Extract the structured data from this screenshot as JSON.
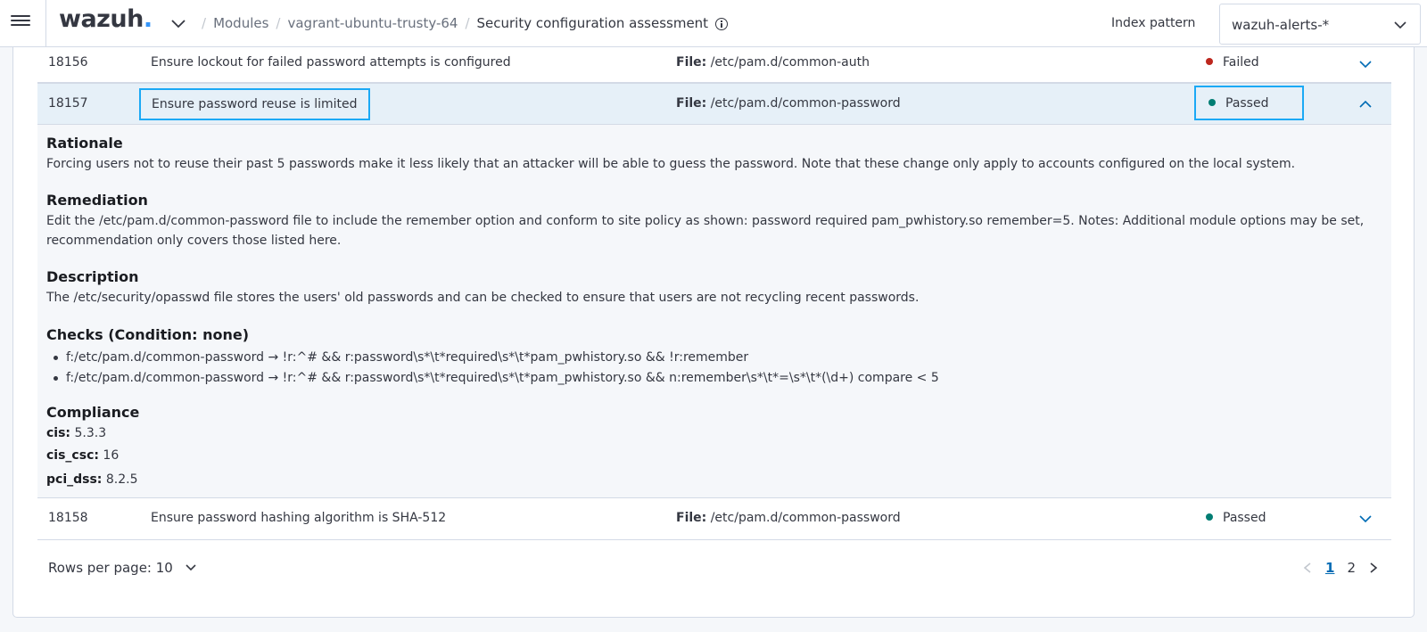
{
  "header": {
    "logo_text": "wazuh",
    "logo_dot": ".",
    "breadcrumbs": [
      "Modules",
      "vagrant-ubuntu-trusty-64",
      "Security configuration assessment"
    ],
    "index_label": "Index pattern",
    "index_value": "wazuh-alerts-*"
  },
  "rows": [
    {
      "id": "18156",
      "title": "Ensure lockout for failed password attempts is configured",
      "file_label": "File:",
      "file": "/etc/pam.d/common-auth",
      "result": "Failed",
      "result_color": "#bd271e"
    },
    {
      "id": "18157",
      "title": "Ensure password reuse is limited",
      "file_label": "File:",
      "file": "/etc/pam.d/common-password",
      "result": "Passed",
      "result_color": "#017d73"
    },
    {
      "id": "18158",
      "title": "Ensure password hashing algorithm is SHA-512",
      "file_label": "File:",
      "file": "/etc/pam.d/common-password",
      "result": "Passed",
      "result_color": "#017d73"
    }
  ],
  "details": {
    "rationale_h": "Rationale",
    "rationale": "Forcing users not to reuse their past 5 passwords make it less likely that an attacker will be able to guess the password. Note that these change only apply to accounts configured on the local system.",
    "remediation_h": "Remediation",
    "remediation": "Edit the /etc/pam.d/common-password file to include the remember option and conform to site policy as shown: password required pam_pwhistory.so remember=5. Notes: Additional module options may be set, recommendation only covers those listed here.",
    "description_h": "Description",
    "description": "The /etc/security/opasswd file stores the users' old passwords and can be checked to ensure that users are not recycling recent passwords.",
    "checks_h": "Checks (Condition: none)",
    "checks": [
      "f:/etc/pam.d/common-password → !r:^# && r:password\\s*\\t*required\\s*\\t*pam_pwhistory.so && !r:remember",
      "f:/etc/pam.d/common-password → !r:^# && r:password\\s*\\t*required\\s*\\t*pam_pwhistory.so && n:remember\\s*\\t*=\\s*\\t*(\\d+) compare < 5"
    ],
    "compliance_h": "Compliance",
    "compliance": [
      {
        "key": "cis:",
        "value": "5.3.3"
      },
      {
        "key": "cis_csc:",
        "value": "16"
      },
      {
        "key": "pci_dss:",
        "value": "8.2.5"
      }
    ]
  },
  "footer": {
    "rows_per_page": "Rows per page: 10",
    "pages": [
      "1",
      "2"
    ]
  }
}
